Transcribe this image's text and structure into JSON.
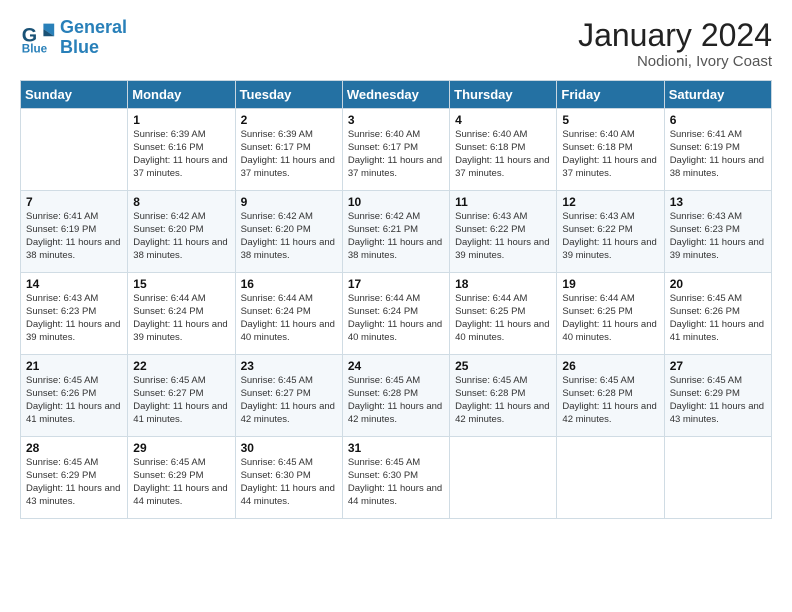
{
  "header": {
    "logo_line1": "General",
    "logo_line2": "Blue",
    "main_title": "January 2024",
    "subtitle": "Nodioni, Ivory Coast"
  },
  "weekdays": [
    "Sunday",
    "Monday",
    "Tuesday",
    "Wednesday",
    "Thursday",
    "Friday",
    "Saturday"
  ],
  "weeks": [
    [
      {
        "day": "",
        "sunrise": "",
        "sunset": "",
        "daylight": ""
      },
      {
        "day": "1",
        "sunrise": "Sunrise: 6:39 AM",
        "sunset": "Sunset: 6:16 PM",
        "daylight": "Daylight: 11 hours and 37 minutes."
      },
      {
        "day": "2",
        "sunrise": "Sunrise: 6:39 AM",
        "sunset": "Sunset: 6:17 PM",
        "daylight": "Daylight: 11 hours and 37 minutes."
      },
      {
        "day": "3",
        "sunrise": "Sunrise: 6:40 AM",
        "sunset": "Sunset: 6:17 PM",
        "daylight": "Daylight: 11 hours and 37 minutes."
      },
      {
        "day": "4",
        "sunrise": "Sunrise: 6:40 AM",
        "sunset": "Sunset: 6:18 PM",
        "daylight": "Daylight: 11 hours and 37 minutes."
      },
      {
        "day": "5",
        "sunrise": "Sunrise: 6:40 AM",
        "sunset": "Sunset: 6:18 PM",
        "daylight": "Daylight: 11 hours and 37 minutes."
      },
      {
        "day": "6",
        "sunrise": "Sunrise: 6:41 AM",
        "sunset": "Sunset: 6:19 PM",
        "daylight": "Daylight: 11 hours and 38 minutes."
      }
    ],
    [
      {
        "day": "7",
        "sunrise": "Sunrise: 6:41 AM",
        "sunset": "Sunset: 6:19 PM",
        "daylight": "Daylight: 11 hours and 38 minutes."
      },
      {
        "day": "8",
        "sunrise": "Sunrise: 6:42 AM",
        "sunset": "Sunset: 6:20 PM",
        "daylight": "Daylight: 11 hours and 38 minutes."
      },
      {
        "day": "9",
        "sunrise": "Sunrise: 6:42 AM",
        "sunset": "Sunset: 6:20 PM",
        "daylight": "Daylight: 11 hours and 38 minutes."
      },
      {
        "day": "10",
        "sunrise": "Sunrise: 6:42 AM",
        "sunset": "Sunset: 6:21 PM",
        "daylight": "Daylight: 11 hours and 38 minutes."
      },
      {
        "day": "11",
        "sunrise": "Sunrise: 6:43 AM",
        "sunset": "Sunset: 6:22 PM",
        "daylight": "Daylight: 11 hours and 39 minutes."
      },
      {
        "day": "12",
        "sunrise": "Sunrise: 6:43 AM",
        "sunset": "Sunset: 6:22 PM",
        "daylight": "Daylight: 11 hours and 39 minutes."
      },
      {
        "day": "13",
        "sunrise": "Sunrise: 6:43 AM",
        "sunset": "Sunset: 6:23 PM",
        "daylight": "Daylight: 11 hours and 39 minutes."
      }
    ],
    [
      {
        "day": "14",
        "sunrise": "Sunrise: 6:43 AM",
        "sunset": "Sunset: 6:23 PM",
        "daylight": "Daylight: 11 hours and 39 minutes."
      },
      {
        "day": "15",
        "sunrise": "Sunrise: 6:44 AM",
        "sunset": "Sunset: 6:24 PM",
        "daylight": "Daylight: 11 hours and 39 minutes."
      },
      {
        "day": "16",
        "sunrise": "Sunrise: 6:44 AM",
        "sunset": "Sunset: 6:24 PM",
        "daylight": "Daylight: 11 hours and 40 minutes."
      },
      {
        "day": "17",
        "sunrise": "Sunrise: 6:44 AM",
        "sunset": "Sunset: 6:24 PM",
        "daylight": "Daylight: 11 hours and 40 minutes."
      },
      {
        "day": "18",
        "sunrise": "Sunrise: 6:44 AM",
        "sunset": "Sunset: 6:25 PM",
        "daylight": "Daylight: 11 hours and 40 minutes."
      },
      {
        "day": "19",
        "sunrise": "Sunrise: 6:44 AM",
        "sunset": "Sunset: 6:25 PM",
        "daylight": "Daylight: 11 hours and 40 minutes."
      },
      {
        "day": "20",
        "sunrise": "Sunrise: 6:45 AM",
        "sunset": "Sunset: 6:26 PM",
        "daylight": "Daylight: 11 hours and 41 minutes."
      }
    ],
    [
      {
        "day": "21",
        "sunrise": "Sunrise: 6:45 AM",
        "sunset": "Sunset: 6:26 PM",
        "daylight": "Daylight: 11 hours and 41 minutes."
      },
      {
        "day": "22",
        "sunrise": "Sunrise: 6:45 AM",
        "sunset": "Sunset: 6:27 PM",
        "daylight": "Daylight: 11 hours and 41 minutes."
      },
      {
        "day": "23",
        "sunrise": "Sunrise: 6:45 AM",
        "sunset": "Sunset: 6:27 PM",
        "daylight": "Daylight: 11 hours and 42 minutes."
      },
      {
        "day": "24",
        "sunrise": "Sunrise: 6:45 AM",
        "sunset": "Sunset: 6:28 PM",
        "daylight": "Daylight: 11 hours and 42 minutes."
      },
      {
        "day": "25",
        "sunrise": "Sunrise: 6:45 AM",
        "sunset": "Sunset: 6:28 PM",
        "daylight": "Daylight: 11 hours and 42 minutes."
      },
      {
        "day": "26",
        "sunrise": "Sunrise: 6:45 AM",
        "sunset": "Sunset: 6:28 PM",
        "daylight": "Daylight: 11 hours and 42 minutes."
      },
      {
        "day": "27",
        "sunrise": "Sunrise: 6:45 AM",
        "sunset": "Sunset: 6:29 PM",
        "daylight": "Daylight: 11 hours and 43 minutes."
      }
    ],
    [
      {
        "day": "28",
        "sunrise": "Sunrise: 6:45 AM",
        "sunset": "Sunset: 6:29 PM",
        "daylight": "Daylight: 11 hours and 43 minutes."
      },
      {
        "day": "29",
        "sunrise": "Sunrise: 6:45 AM",
        "sunset": "Sunset: 6:29 PM",
        "daylight": "Daylight: 11 hours and 44 minutes."
      },
      {
        "day": "30",
        "sunrise": "Sunrise: 6:45 AM",
        "sunset": "Sunset: 6:30 PM",
        "daylight": "Daylight: 11 hours and 44 minutes."
      },
      {
        "day": "31",
        "sunrise": "Sunrise: 6:45 AM",
        "sunset": "Sunset: 6:30 PM",
        "daylight": "Daylight: 11 hours and 44 minutes."
      },
      {
        "day": "",
        "sunrise": "",
        "sunset": "",
        "daylight": ""
      },
      {
        "day": "",
        "sunrise": "",
        "sunset": "",
        "daylight": ""
      },
      {
        "day": "",
        "sunrise": "",
        "sunset": "",
        "daylight": ""
      }
    ]
  ]
}
